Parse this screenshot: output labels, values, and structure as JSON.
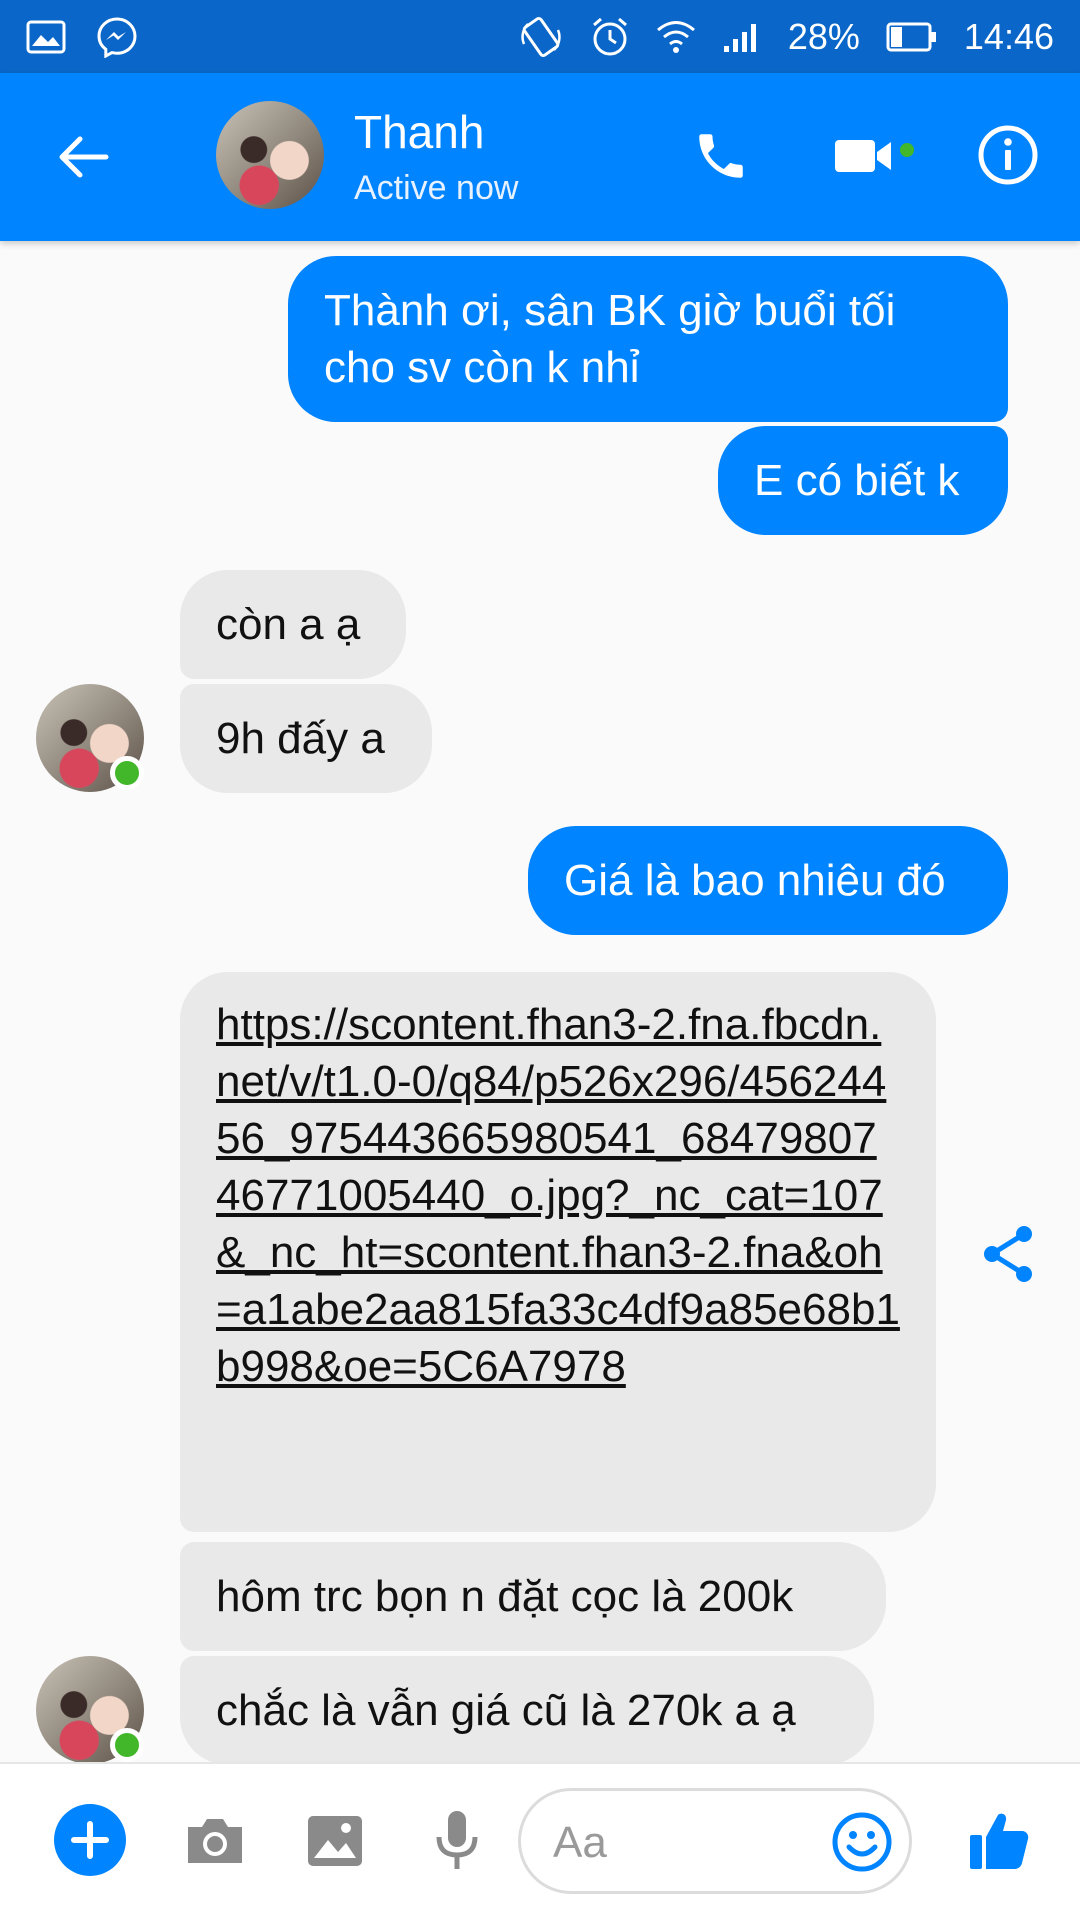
{
  "status_bar": {
    "battery": "28%",
    "time": "14:46",
    "icons": [
      "gallery-icon",
      "messenger-icon",
      "rotate-icon",
      "alarm-icon",
      "wifi-icon",
      "signal-icon",
      "battery-icon"
    ]
  },
  "header": {
    "contact_name": "Thanh",
    "contact_status": "Active now",
    "colors": {
      "bar": "#0084ff",
      "status_bar": "#0a66c8",
      "online": "#42b72a"
    }
  },
  "messages": [
    {
      "side": "out",
      "text": "Thành ơi, sân BK giờ buổi tối cho sv còn k nhỉ"
    },
    {
      "side": "out",
      "text": "E có biết k"
    },
    {
      "side": "in",
      "text": "còn a ạ"
    },
    {
      "side": "in",
      "text": "9h đấy a"
    },
    {
      "side": "out",
      "text": "Giá là bao nhiêu đó"
    },
    {
      "side": "in",
      "text": "https://scontent.fhan3-2.fna.fbcdn.net/v/t1.0-0/q84/p526x296/45624456_975443665980541_6847980746771005440_o.jpg?_nc_cat=107&_nc_ht=scontent.fhan3-2.fna&oh=a1abe2aa815fa33c4df9a85e68b1b998&oe=5C6A7978"
    },
    {
      "side": "in",
      "text": "hôm trc bọn n đặt cọc là 200k"
    },
    {
      "side": "in",
      "text": "chắc là vẫn giá cũ là 270k a ạ"
    }
  ],
  "composer": {
    "placeholder": "Aa"
  }
}
